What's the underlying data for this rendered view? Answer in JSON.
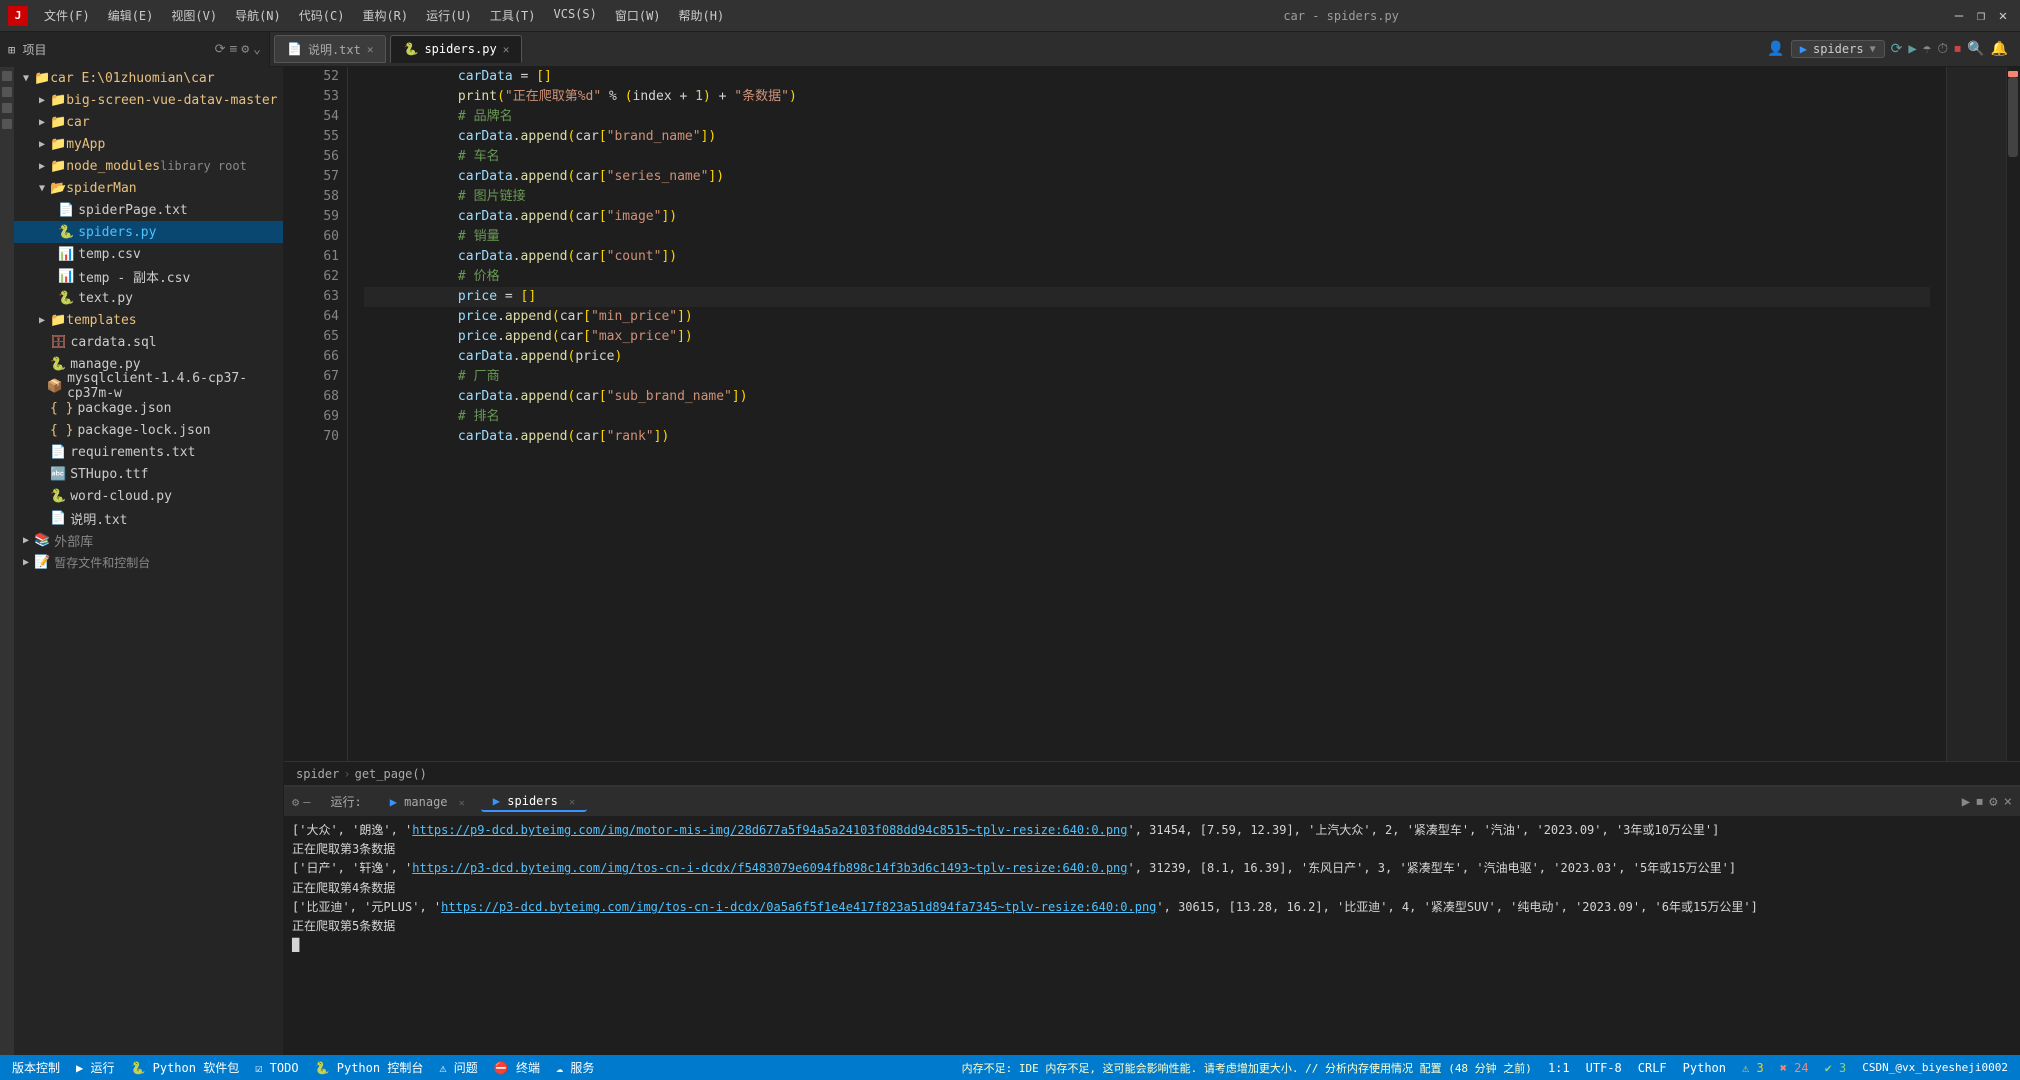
{
  "titlebar": {
    "logo_text": "J",
    "menus": [
      "文件(F)",
      "编辑(E)",
      "视图(V)",
      "导航(N)",
      "代码(C)",
      "重构(R)",
      "运行(U)",
      "工具(T)",
      "VCS(S)",
      "窗口(W)",
      "帮助(H)"
    ],
    "center_title": "car - spiders.py",
    "controls": [
      "—",
      "❐",
      "✕"
    ]
  },
  "tabs": {
    "items": [
      {
        "label": "说明.txt",
        "type": "txt",
        "active": false
      },
      {
        "label": "spiders.py",
        "type": "py",
        "active": true
      }
    ],
    "run_config": {
      "config_name": "spiders",
      "run_btn": "▶ 运行",
      "debug_icons": [
        "⟳",
        "▶",
        "⏸",
        "⏹",
        "↩",
        "↪",
        "⏬"
      ]
    }
  },
  "sidebar": {
    "header_label": "项目",
    "tree": [
      {
        "level": 0,
        "type": "folder",
        "label": "car E:\\01zhuomian\\car",
        "open": true,
        "expanded": true
      },
      {
        "level": 1,
        "type": "folder",
        "label": "big-screen-vue-datav-master",
        "open": false
      },
      {
        "level": 1,
        "type": "folder",
        "label": "car",
        "open": false
      },
      {
        "level": 1,
        "type": "folder",
        "label": "myApp",
        "open": false
      },
      {
        "level": 1,
        "type": "folder",
        "label": "node_modules  library root",
        "open": false
      },
      {
        "level": 1,
        "type": "folder",
        "label": "spiderMan",
        "open": true,
        "expanded": true,
        "selected": false
      },
      {
        "level": 2,
        "type": "file",
        "ext": "py",
        "label": "spiderPage.txt"
      },
      {
        "level": 2,
        "type": "file",
        "ext": "py",
        "label": "spiders.py",
        "active": true
      },
      {
        "level": 2,
        "type": "file",
        "ext": "csv",
        "label": "temp.csv"
      },
      {
        "level": 2,
        "type": "file",
        "ext": "csv",
        "label": "temp - 副本.csv"
      },
      {
        "level": 2,
        "type": "file",
        "ext": "py",
        "label": "text.py"
      },
      {
        "level": 1,
        "type": "folder",
        "label": "templates",
        "open": false
      },
      {
        "level": 1,
        "type": "file",
        "ext": "sql",
        "label": "cardata.sql"
      },
      {
        "level": 1,
        "type": "file",
        "ext": "py",
        "label": "manage.py"
      },
      {
        "level": 1,
        "type": "file",
        "ext": "lib",
        "label": "mysqlclient-1.4.6-cp37-cp37m-w"
      },
      {
        "level": 1,
        "type": "file",
        "ext": "json",
        "label": "package.json"
      },
      {
        "level": 1,
        "type": "file",
        "ext": "json",
        "label": "package-lock.json"
      },
      {
        "level": 1,
        "type": "file",
        "ext": "txt",
        "label": "requirements.txt"
      },
      {
        "level": 1,
        "type": "file",
        "ext": "ttf",
        "label": "STHupo.ttf"
      },
      {
        "level": 1,
        "type": "file",
        "ext": "py",
        "label": "word-cloud.py"
      },
      {
        "level": 1,
        "type": "file",
        "ext": "txt",
        "label": "说明.txt"
      },
      {
        "level": 0,
        "type": "folder",
        "label": "外部库",
        "open": false
      }
    ]
  },
  "editor": {
    "breadcrumb": [
      "spider",
      "get_page()"
    ],
    "lines": [
      {
        "num": 52,
        "code": "            carData = []"
      },
      {
        "num": 53,
        "code": "            print(\"正在爬取第%d\" % (index + 1) + \"条数据\")"
      },
      {
        "num": 54,
        "code": "            # 品牌名"
      },
      {
        "num": 55,
        "code": "            carData.append(car[\"brand_name\"])"
      },
      {
        "num": 56,
        "code": "            # 车名"
      },
      {
        "num": 57,
        "code": "            carData.append(car[\"series_name\"])"
      },
      {
        "num": 58,
        "code": "            # 图片链接"
      },
      {
        "num": 59,
        "code": "            carData.append(car[\"image\"])"
      },
      {
        "num": 60,
        "code": "            # 销量"
      },
      {
        "num": 61,
        "code": "            carData.append(car[\"count\"])"
      },
      {
        "num": 62,
        "code": "            # 价格"
      },
      {
        "num": 63,
        "code": "            price = []",
        "highlighted": true
      },
      {
        "num": 64,
        "code": "            price.append(car[\"min_price\"])"
      },
      {
        "num": 65,
        "code": "            price.append(car[\"max_price\"])"
      },
      {
        "num": 66,
        "code": "            carData.append(price)"
      },
      {
        "num": 67,
        "code": "            # 厂商"
      },
      {
        "num": 68,
        "code": "            carData.append(car[\"sub_brand_name\"])"
      },
      {
        "num": 69,
        "code": "            # 排名"
      },
      {
        "num": 70,
        "code": "            carData.append(car[\"rank\"])"
      }
    ]
  },
  "bottom_panel": {
    "tabs": [
      {
        "label": "运行:",
        "icon": "▶",
        "type": "run_label"
      },
      {
        "label": "manage",
        "type": "manage",
        "active": false
      },
      {
        "label": "spiders",
        "type": "spiders",
        "active": true
      }
    ],
    "output_lines": [
      {
        "type": "data",
        "prefix": "['大众', '朗逸', '",
        "link": "https://p9-dcd.byteimg.com/img/motor-mis-img/28d677a5f94a5a24103f088dd94c8515~tplv-resize:640:0.png",
        "suffix": "', 31454, [7.59, 12.39], '上汽大众', 2, '紧凑型车', '汽油', '2023.09', '3年或10万公里']"
      },
      {
        "type": "status",
        "text": "正在爬取第3条数据"
      },
      {
        "type": "data",
        "prefix": "['日产', '轩逸', '",
        "link": "https://p3-dcd.byteimg.com/img/tos-cn-i-dcdx/f5483079e6094fb898c14f3b3d6c1493~tplv-resize:640:0.png",
        "suffix": "', 31239, [8.1, 16.39], '东风日产', 3, '紧凑型车', '汽油电驱', '2023.03', '5年或15万公里']"
      },
      {
        "type": "status",
        "text": "正在爬取第4条数据"
      },
      {
        "type": "data",
        "prefix": "['比亚迪', '元PLUS', '",
        "link": "https://p3-dcd.byteimg.com/img/tos-cn-i-dcdx/0a5a6f5f1e4e417f823a51d894fa7345~tplv-resize:640:0.png",
        "suffix": "', 30615, [13.28, 16.2], '比亚迪', 4, '紧凑型SUV', '纯电动', '2023.09', '6年或15万公里']"
      },
      {
        "type": "status",
        "text": "正在爬取第5条数据"
      }
    ]
  },
  "status_bar": {
    "left_items": [
      "版本控制",
      "▶ 运行",
      "🐍 Python 软件包",
      "☑ TODO",
      "🐍 Python 控制台",
      "⚠ 问题",
      "⛔ 终端",
      "☁ 服务"
    ],
    "right_text": "内存不足: IDE 内存不足, 这可能会影响性能. 请考虑增加更大小. // 分析内存使用情况  配置 (48 分钟 之前)",
    "col_info": "1:1",
    "encoding": "UTF-8",
    "line_sep": "CRLF",
    "lang": "Python",
    "user": "CSDN_@vx_biyesheji0002",
    "warnings": "3",
    "errors": "24",
    "ok": "3"
  }
}
